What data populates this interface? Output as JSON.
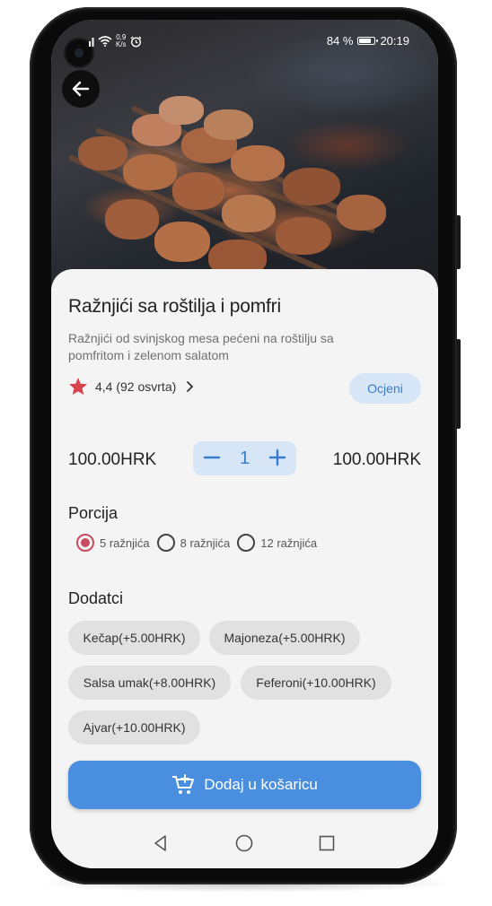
{
  "status": {
    "net_speed_value": "0,9",
    "net_speed_unit": "K/s",
    "battery": "84 %",
    "battery_level": 0.84,
    "time": "20:19"
  },
  "product": {
    "title": "Ražnjići sa roštilja i pomfri",
    "description": "Ražnjići od svinjskog mesa pećeni na roštilju sa pomfritom i zelenom salatom",
    "rating": "4,4 (92 osvrta)",
    "rate_label": "Ocjeni"
  },
  "pricing": {
    "unit_price": "100.00HRK",
    "quantity": "1",
    "total_price": "100.00HRK"
  },
  "portion": {
    "heading": "Porcija",
    "options": [
      {
        "label": "5 ražnjića",
        "selected": true
      },
      {
        "label": "8 ražnjića",
        "selected": false
      },
      {
        "label": "12 ražnjića",
        "selected": false
      }
    ]
  },
  "extras": {
    "heading": "Dodatci",
    "items": [
      "Kečap(+5.00HRK)",
      "Majoneza(+5.00HRK)",
      "Salsa umak(+8.00HRK)",
      "Feferoni(+10.00HRK)",
      "Ajvar(+10.00HRK)"
    ]
  },
  "cart": {
    "label": "Dodaj u košaricu"
  },
  "colors": {
    "primary": "#4a8ee0",
    "primary_light": "#d7e6f6",
    "accent_red": "#d9434f",
    "radio_selected": "#c84b5f"
  },
  "icons": {
    "back": "arrow-left-icon",
    "star": "star-icon",
    "chevron": "chevron-right-icon",
    "cart": "add-cart-icon",
    "nav_back": "triangle-back-icon",
    "nav_home": "circle-home-icon",
    "nav_recent": "square-recent-icon"
  }
}
